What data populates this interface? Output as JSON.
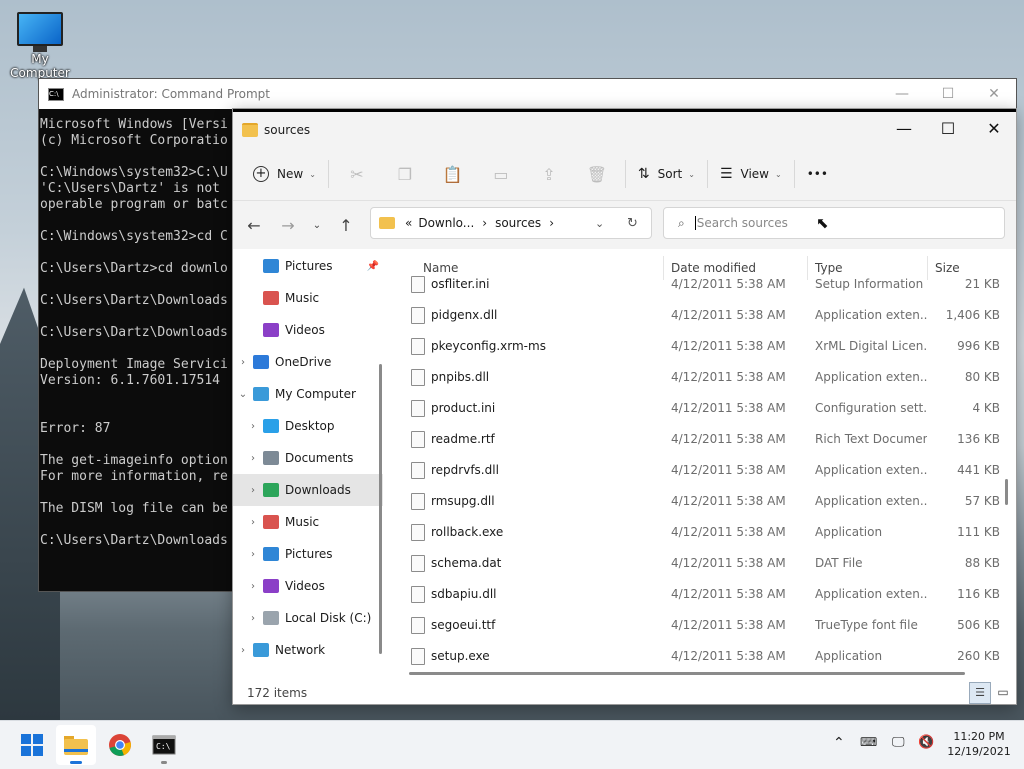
{
  "desktop": {
    "icon_label": "My Computer"
  },
  "cmd": {
    "title": "Administrator: Command Prompt",
    "lines": [
      "Microsoft Windows [Versi",
      "(c) Microsoft Corporatio",
      "",
      "C:\\Windows\\system32>C:\\U",
      "'C:\\Users\\Dartz' is not",
      "operable program or batc",
      "",
      "C:\\Windows\\system32>cd C",
      "",
      "C:\\Users\\Dartz>cd downlo",
      "",
      "C:\\Users\\Dartz\\Downloads",
      "",
      "C:\\Users\\Dartz\\Downloads",
      "",
      "Deployment Image Servici",
      "Version: 6.1.7601.17514",
      "",
      "",
      "Error: 87",
      "",
      "The get-imageinfo option",
      "For more information, re",
      "",
      "The DISM log file can be",
      "",
      "C:\\Users\\Dartz\\Downloads"
    ]
  },
  "explorer": {
    "title": "sources",
    "toolbar": {
      "new": "New",
      "sort": "Sort",
      "view": "View",
      "more": "•••"
    },
    "address": {
      "prefix": "«",
      "crumb1": "Downlo...",
      "crumb2": "sources"
    },
    "search": {
      "placeholder": "Search sources"
    },
    "nav": [
      {
        "label": "Pictures",
        "color": "#2f86d6",
        "indent": 1,
        "pinned": true
      },
      {
        "label": "Music",
        "color": "#d9534f",
        "indent": 1
      },
      {
        "label": "Videos",
        "color": "#8b3fc7",
        "indent": 1
      },
      {
        "label": "OneDrive",
        "color": "#2d7ad9",
        "indent": 0,
        "arrow": "›"
      },
      {
        "label": "My Computer",
        "color": "#3a9ad9",
        "indent": 0,
        "arrow": "⌄"
      },
      {
        "label": "Desktop",
        "color": "#2aa0e8",
        "indent": 1,
        "arrow": "›"
      },
      {
        "label": "Documents",
        "color": "#7d8a96",
        "indent": 1,
        "arrow": "›"
      },
      {
        "label": "Downloads",
        "color": "#2ca55a",
        "indent": 1,
        "arrow": "›",
        "selected": true
      },
      {
        "label": "Music",
        "color": "#d9534f",
        "indent": 1,
        "arrow": "›"
      },
      {
        "label": "Pictures",
        "color": "#2f86d6",
        "indent": 1,
        "arrow": "›"
      },
      {
        "label": "Videos",
        "color": "#8b3fc7",
        "indent": 1,
        "arrow": "›"
      },
      {
        "label": "Local Disk (C:)",
        "color": "#9aa4ad",
        "indent": 1,
        "arrow": "›"
      },
      {
        "label": "Network",
        "color": "#3a9ad9",
        "indent": 0,
        "arrow": "›"
      }
    ],
    "columns": {
      "name": "Name",
      "date": "Date modified",
      "type": "Type",
      "size": "Size"
    },
    "files": [
      {
        "name": "osfliter.ini",
        "date": "4/12/2011 5:38 AM",
        "type": "Setup Information",
        "size": "21 KB"
      },
      {
        "name": "pidgenx.dll",
        "date": "4/12/2011 5:38 AM",
        "type": "Application exten...",
        "size": "1,406 KB"
      },
      {
        "name": "pkeyconfig.xrm-ms",
        "date": "4/12/2011 5:38 AM",
        "type": "XrML Digital Licen...",
        "size": "996 KB"
      },
      {
        "name": "pnpibs.dll",
        "date": "4/12/2011 5:38 AM",
        "type": "Application exten...",
        "size": "80 KB"
      },
      {
        "name": "product.ini",
        "date": "4/12/2011 5:38 AM",
        "type": "Configuration sett...",
        "size": "4 KB"
      },
      {
        "name": "readme.rtf",
        "date": "4/12/2011 5:38 AM",
        "type": "Rich Text Document",
        "size": "136 KB"
      },
      {
        "name": "repdrvfs.dll",
        "date": "4/12/2011 5:38 AM",
        "type": "Application exten...",
        "size": "441 KB"
      },
      {
        "name": "rmsupg.dll",
        "date": "4/12/2011 5:38 AM",
        "type": "Application exten...",
        "size": "57 KB"
      },
      {
        "name": "rollback.exe",
        "date": "4/12/2011 5:38 AM",
        "type": "Application",
        "size": "111 KB"
      },
      {
        "name": "schema.dat",
        "date": "4/12/2011 5:38 AM",
        "type": "DAT File",
        "size": "88 KB"
      },
      {
        "name": "sdbapiu.dll",
        "date": "4/12/2011 5:38 AM",
        "type": "Application exten...",
        "size": "116 KB"
      },
      {
        "name": "segoeui.ttf",
        "date": "4/12/2011 5:38 AM",
        "type": "TrueType font file",
        "size": "506 KB"
      },
      {
        "name": "setup.exe",
        "date": "4/12/2011 5:38 AM",
        "type": "Application",
        "size": "260 KB"
      }
    ],
    "status": "172 items"
  },
  "taskbar": {
    "time": "11:20 PM",
    "date": "12/19/2021"
  }
}
